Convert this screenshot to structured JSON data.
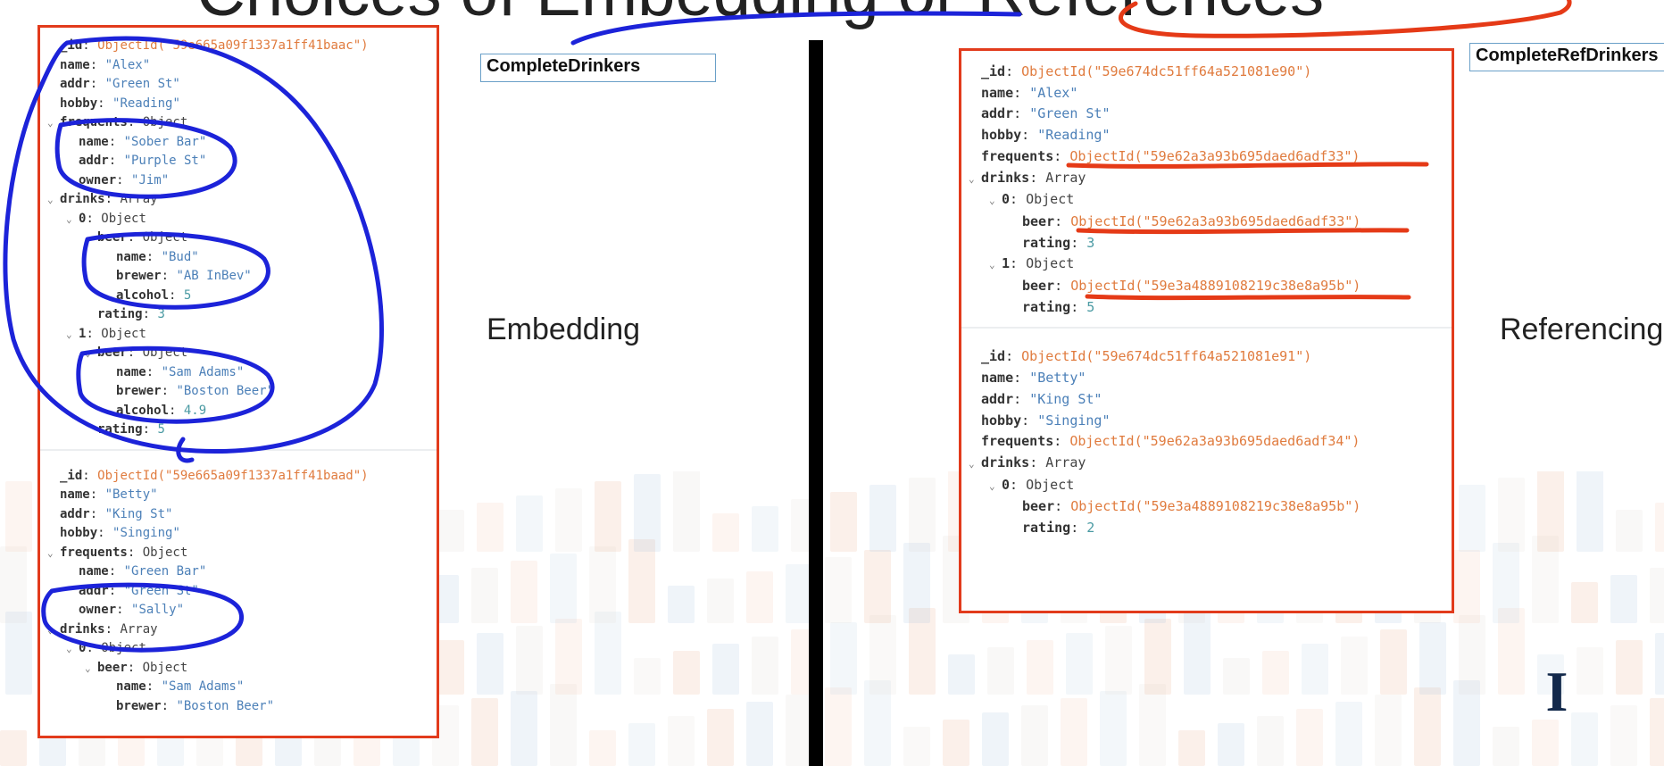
{
  "slide": {
    "title": "Choices of Embedding or References",
    "left_tag": "CompleteDrinkers",
    "right_tag": "CompleteRefDrinkers",
    "left_label": "Embedding",
    "right_label": "Referencing"
  },
  "colors": {
    "frame": "#e23b1c",
    "key": "#333333",
    "string_value": "#4c80b8",
    "objectid_value": "#e07b3e",
    "number_value": "#4a9aa3",
    "blue_ink": "#1c23d9",
    "red_ink": "#e53a17"
  },
  "left_docs": [
    {
      "lines": [
        {
          "i": 0,
          "c": false,
          "k": "_id",
          "v": "ObjectId(\"59e665a09f1337a1ff41baac\")",
          "t": "o"
        },
        {
          "i": 0,
          "c": false,
          "k": "name",
          "v": "\"Alex\"",
          "t": "s"
        },
        {
          "i": 0,
          "c": false,
          "k": "addr",
          "v": "\"Green St\"",
          "t": "s"
        },
        {
          "i": 0,
          "c": false,
          "k": "hobby",
          "v": "\"Reading\"",
          "t": "s"
        },
        {
          "i": 0,
          "c": true,
          "k": "frequents",
          "v": "Object",
          "t": "t"
        },
        {
          "i": 1,
          "c": false,
          "k": "name",
          "v": "\"Sober Bar\"",
          "t": "s"
        },
        {
          "i": 1,
          "c": false,
          "k": "addr",
          "v": "\"Purple St\"",
          "t": "s"
        },
        {
          "i": 1,
          "c": false,
          "k": "owner",
          "v": "\"Jim\"",
          "t": "s"
        },
        {
          "i": 0,
          "c": true,
          "k": "drinks",
          "v": "Array",
          "t": "t"
        },
        {
          "i": 1,
          "c": true,
          "k": "0",
          "v": "Object",
          "t": "t"
        },
        {
          "i": 2,
          "c": true,
          "k": "beer",
          "v": "Object",
          "t": "t"
        },
        {
          "i": 3,
          "c": false,
          "k": "name",
          "v": "\"Bud\"",
          "t": "s"
        },
        {
          "i": 3,
          "c": false,
          "k": "brewer",
          "v": "\"AB InBev\"",
          "t": "s"
        },
        {
          "i": 3,
          "c": false,
          "k": "alcohol",
          "v": "5",
          "t": "n"
        },
        {
          "i": 2,
          "c": false,
          "k": "rating",
          "v": "3",
          "t": "n"
        },
        {
          "i": 1,
          "c": true,
          "k": "1",
          "v": "Object",
          "t": "t"
        },
        {
          "i": 2,
          "c": true,
          "k": "beer",
          "v": "Object",
          "t": "t"
        },
        {
          "i": 3,
          "c": false,
          "k": "name",
          "v": "\"Sam Adams\"",
          "t": "s"
        },
        {
          "i": 3,
          "c": false,
          "k": "brewer",
          "v": "\"Boston Beer\"",
          "t": "s"
        },
        {
          "i": 3,
          "c": false,
          "k": "alcohol",
          "v": "4.9",
          "t": "n"
        },
        {
          "i": 2,
          "c": false,
          "k": "rating",
          "v": "5",
          "t": "n"
        }
      ]
    },
    {
      "lines": [
        {
          "i": 0,
          "c": false,
          "k": "_id",
          "v": "ObjectId(\"59e665a09f1337a1ff41baad\")",
          "t": "o"
        },
        {
          "i": 0,
          "c": false,
          "k": "name",
          "v": "\"Betty\"",
          "t": "s"
        },
        {
          "i": 0,
          "c": false,
          "k": "addr",
          "v": "\"King St\"",
          "t": "s"
        },
        {
          "i": 0,
          "c": false,
          "k": "hobby",
          "v": "\"Singing\"",
          "t": "s"
        },
        {
          "i": 0,
          "c": true,
          "k": "frequents",
          "v": "Object",
          "t": "t"
        },
        {
          "i": 1,
          "c": false,
          "k": "name",
          "v": "\"Green Bar\"",
          "t": "s"
        },
        {
          "i": 1,
          "c": false,
          "k": "addr",
          "v": "\"Green St\"",
          "t": "s"
        },
        {
          "i": 1,
          "c": false,
          "k": "owner",
          "v": "\"Sally\"",
          "t": "s"
        },
        {
          "i": 0,
          "c": true,
          "k": "drinks",
          "v": "Array",
          "t": "t"
        },
        {
          "i": 1,
          "c": true,
          "k": "0",
          "v": "Object",
          "t": "t"
        },
        {
          "i": 2,
          "c": true,
          "k": "beer",
          "v": "Object",
          "t": "t"
        },
        {
          "i": 3,
          "c": false,
          "k": "name",
          "v": "\"Sam Adams\"",
          "t": "s"
        },
        {
          "i": 3,
          "c": false,
          "k": "brewer",
          "v": "\"Boston Beer\"",
          "t": "s"
        }
      ]
    }
  ],
  "right_docs": [
    {
      "lines": [
        {
          "i": 0,
          "c": false,
          "k": "_id",
          "v": "ObjectId(\"59e674dc51ff64a521081e90\")",
          "t": "o"
        },
        {
          "i": 0,
          "c": false,
          "k": "name",
          "v": "\"Alex\"",
          "t": "s"
        },
        {
          "i": 0,
          "c": false,
          "k": "addr",
          "v": "\"Green St\"",
          "t": "s"
        },
        {
          "i": 0,
          "c": false,
          "k": "hobby",
          "v": "\"Reading\"",
          "t": "s"
        },
        {
          "i": 0,
          "c": false,
          "k": "frequents",
          "v": "ObjectId(\"59e62a3a93b695daed6adf33\")",
          "t": "o"
        },
        {
          "i": 0,
          "c": true,
          "k": "drinks",
          "v": "Array",
          "t": "t"
        },
        {
          "i": 1,
          "c": true,
          "k": "0",
          "v": "Object",
          "t": "t"
        },
        {
          "i": 2,
          "c": false,
          "k": "beer",
          "v": "ObjectId(\"59e62a3a93b695daed6adf33\")",
          "t": "o"
        },
        {
          "i": 2,
          "c": false,
          "k": "rating",
          "v": "3",
          "t": "n"
        },
        {
          "i": 1,
          "c": true,
          "k": "1",
          "v": "Object",
          "t": "t"
        },
        {
          "i": 2,
          "c": false,
          "k": "beer",
          "v": "ObjectId(\"59e3a4889108219c38e8a95b\")",
          "t": "o"
        },
        {
          "i": 2,
          "c": false,
          "k": "rating",
          "v": "5",
          "t": "n"
        }
      ]
    },
    {
      "lines": [
        {
          "i": 0,
          "c": false,
          "k": "_id",
          "v": "ObjectId(\"59e674dc51ff64a521081e91\")",
          "t": "o"
        },
        {
          "i": 0,
          "c": false,
          "k": "name",
          "v": "\"Betty\"",
          "t": "s"
        },
        {
          "i": 0,
          "c": false,
          "k": "addr",
          "v": "\"King St\"",
          "t": "s"
        },
        {
          "i": 0,
          "c": false,
          "k": "hobby",
          "v": "\"Singing\"",
          "t": "s"
        },
        {
          "i": 0,
          "c": false,
          "k": "frequents",
          "v": "ObjectId(\"59e62a3a93b695daed6adf34\")",
          "t": "o"
        },
        {
          "i": 0,
          "c": true,
          "k": "drinks",
          "v": "Array",
          "t": "t"
        },
        {
          "i": 1,
          "c": true,
          "k": "0",
          "v": "Object",
          "t": "t"
        },
        {
          "i": 2,
          "c": false,
          "k": "beer",
          "v": "ObjectId(\"59e3a4889108219c38e8a95b\")",
          "t": "o"
        },
        {
          "i": 2,
          "c": false,
          "k": "rating",
          "v": "2",
          "t": "n"
        }
      ]
    }
  ]
}
